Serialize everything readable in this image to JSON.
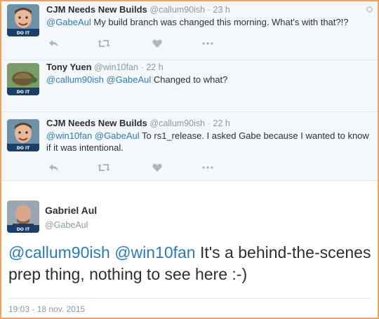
{
  "replies": [
    {
      "name": "CJM Needs New Builds",
      "handle": "@callum90ish",
      "sep": "·",
      "time": "23 h",
      "mentions": [
        "@GabeAul"
      ],
      "text": " My build branch was changed this morning. What's with that?!?",
      "avatar_text": "DO IT",
      "avatar_color": "#6e91a8"
    },
    {
      "name": "Tony Yuen",
      "handle": "@win10fan",
      "sep": "·",
      "time": "22 h",
      "mentions": [
        "@callum90ish",
        "@GabeAul"
      ],
      "text": " Changed to what?",
      "avatar_text": "DO IT",
      "avatar_color": "#7a9c6a"
    },
    {
      "name": "CJM Needs New Builds",
      "handle": "@callum90ish",
      "sep": "·",
      "time": "22 h",
      "mentions": [
        "@win10fan",
        "@GabeAul"
      ],
      "text": " To rs1_release. I asked Gabe because I wanted to know if it was intentional.",
      "avatar_text": "DO IT",
      "avatar_color": "#6e91a8"
    }
  ],
  "main": {
    "name": "Gabriel Aul",
    "handle": "@GabeAul",
    "mentions": [
      "@callum90ish",
      "@win10fan"
    ],
    "text": " It's a behind-the-scenes prep thing, nothing to see here :-)",
    "date": "19:03 - 18 nov. 2015",
    "avatar_text": "DO IT"
  },
  "actions": [
    "reply-icon",
    "retweet-icon",
    "like-icon",
    "more-icon"
  ],
  "colors": {
    "link": "#2b7bb9",
    "muted": "#8899a6",
    "reply_bg": "#f5f8fa",
    "border_accent": "#f0a35e"
  }
}
